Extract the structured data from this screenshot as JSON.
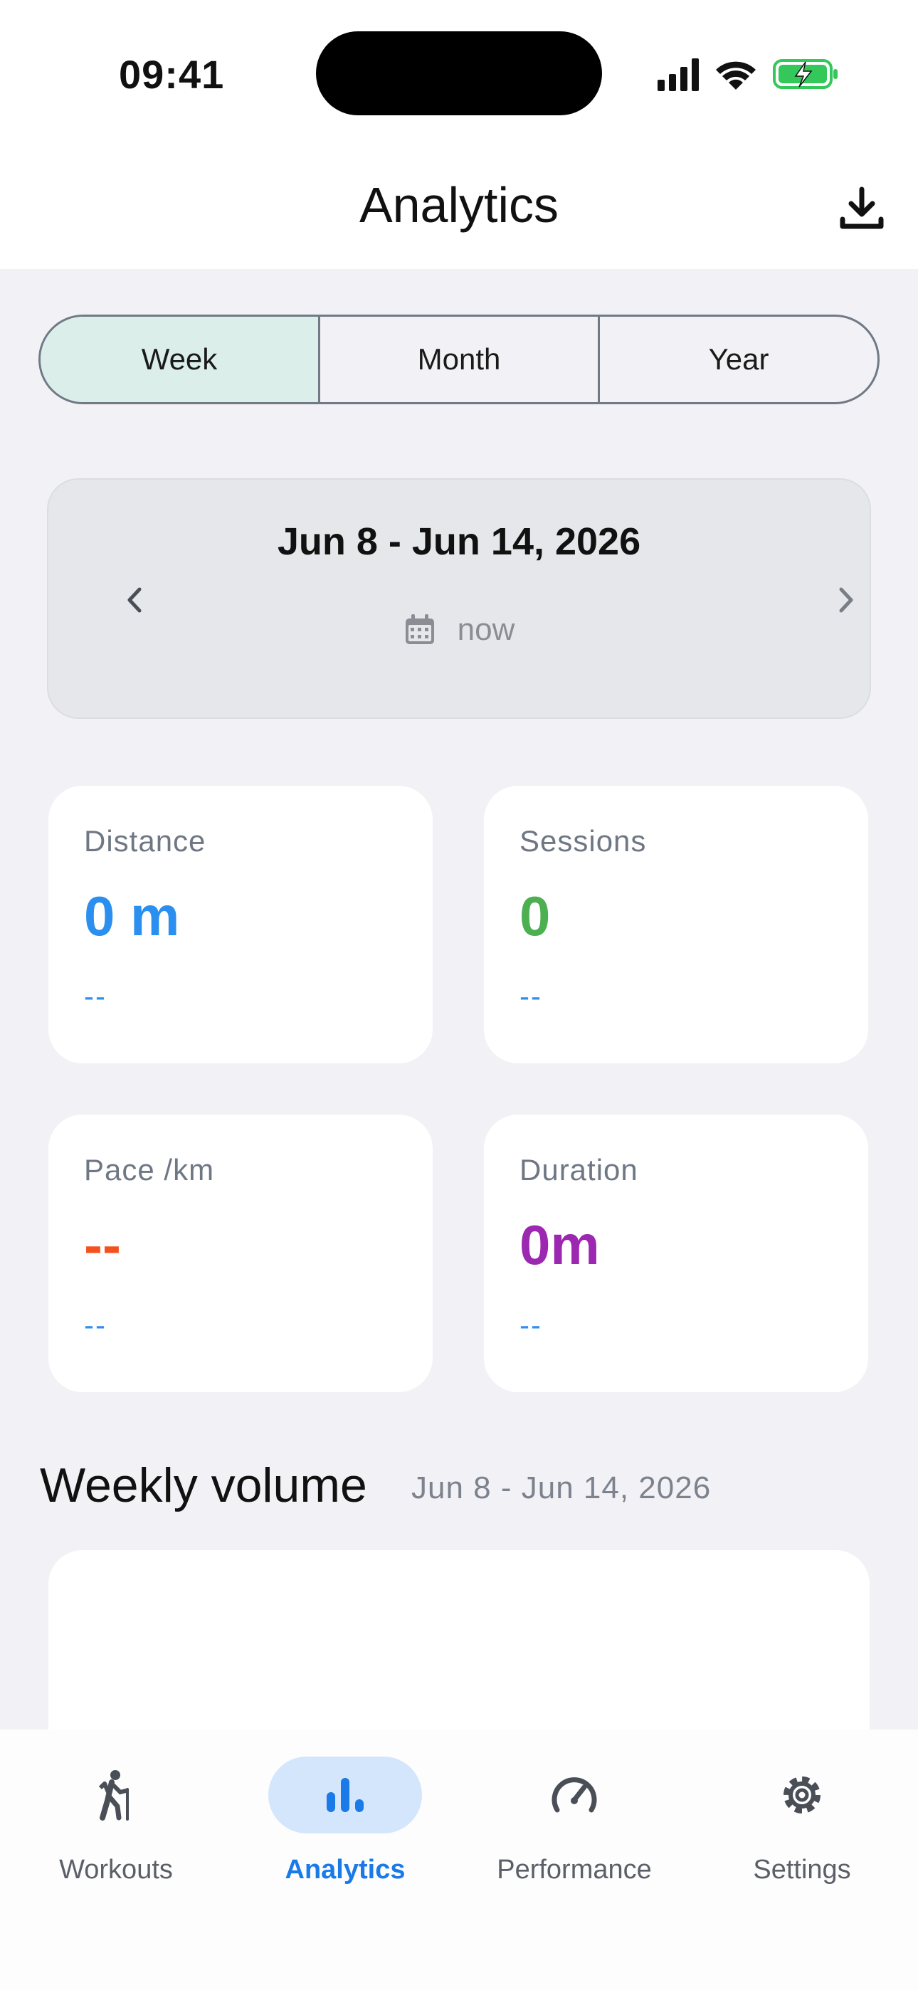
{
  "status": {
    "time": "09:41"
  },
  "header": {
    "title": "Analytics"
  },
  "period_tabs": [
    {
      "label": "Week",
      "active": true
    },
    {
      "label": "Month",
      "active": false
    },
    {
      "label": "Year",
      "active": false
    }
  ],
  "date_card": {
    "range": "Jun 8 - Jun 14, 2026",
    "now_label": "now"
  },
  "stats": {
    "distance": {
      "label": "Distance",
      "value": "0 m",
      "sub": "--",
      "color": "#2a8fee"
    },
    "sessions": {
      "label": "Sessions",
      "value": "0",
      "sub": "--",
      "color": "#4caf50"
    },
    "pace": {
      "label": "Pace /km",
      "value": "--",
      "sub": "--",
      "color": "#f4511e"
    },
    "duration": {
      "label": "Duration",
      "value": "0m",
      "sub": "--",
      "color": "#9c27b0"
    }
  },
  "weekly_volume": {
    "title": "Weekly volume",
    "range": "Jun 8 - Jun 14, 2026"
  },
  "bottom_nav": [
    {
      "label": "Workouts",
      "icon": "hiking-icon",
      "active": false
    },
    {
      "label": "Analytics",
      "icon": "bar-chart-icon",
      "active": true
    },
    {
      "label": "Performance",
      "icon": "speedometer-icon",
      "active": false
    },
    {
      "label": "Settings",
      "icon": "gear-icon",
      "active": false
    }
  ],
  "colors": {
    "accent": "#1a7ae8",
    "active_tab_bg": "#dbeeea",
    "battery_green": "#34c759"
  }
}
